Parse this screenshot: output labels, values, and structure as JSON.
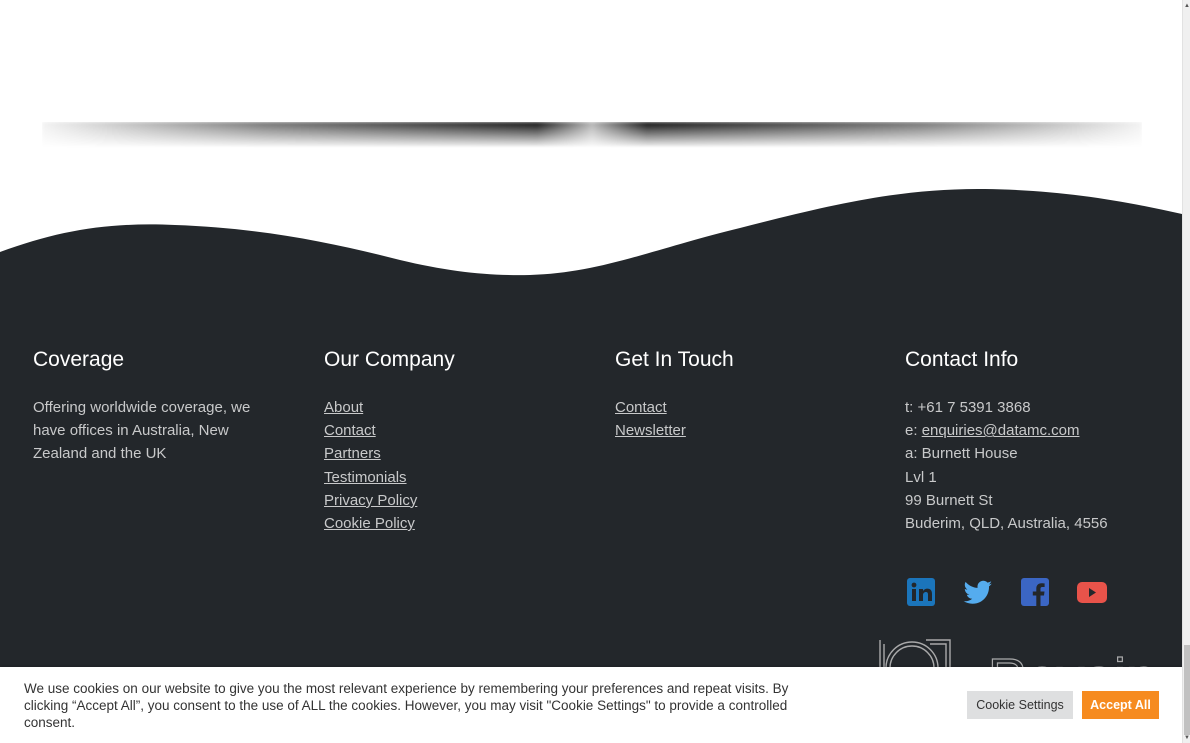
{
  "footer": {
    "columns": {
      "coverage": {
        "heading": "Coverage",
        "text": "Offering worldwide coverage, we have offices in Australia, New Zealand and the UK"
      },
      "company": {
        "heading": "Our Company",
        "links": [
          "About",
          "Contact",
          "Partners",
          "Testimonials",
          "Privacy Policy",
          "Cookie Policy"
        ]
      },
      "touch": {
        "heading": "Get In Touch",
        "links": [
          "Contact",
          "Newsletter"
        ]
      },
      "contact": {
        "heading": "Contact Info",
        "phone": "t: +61 7 5391 3868",
        "email_prefix": "e: ",
        "email": "enquiries@datamc.com",
        "address_lines": [
          "a: Burnett House",
          "Lvl 1",
          "99 Burnett St",
          "Buderim, QLD, Australia, 4556"
        ]
      }
    },
    "social": [
      {
        "name": "linkedin-icon",
        "color": "#1b75bb"
      },
      {
        "name": "twitter-icon",
        "color": "#55acee"
      },
      {
        "name": "facebook-icon",
        "color": "#3b66c4"
      },
      {
        "name": "youtube-icon",
        "color": "#e8534a"
      }
    ],
    "background_color": "#23272b"
  },
  "watermark": {
    "text": "Revain"
  },
  "cookie_banner": {
    "text": "We use cookies on our website to give you the most relevant experience by remembering your preferences and repeat visits. By clicking “Accept All”, you consent to the use of ALL the cookies. However, you may visit \"Cookie Settings\" to provide a controlled consent.",
    "settings_label": "Cookie Settings",
    "accept_label": "Accept All",
    "accept_color": "#f68b1f"
  }
}
